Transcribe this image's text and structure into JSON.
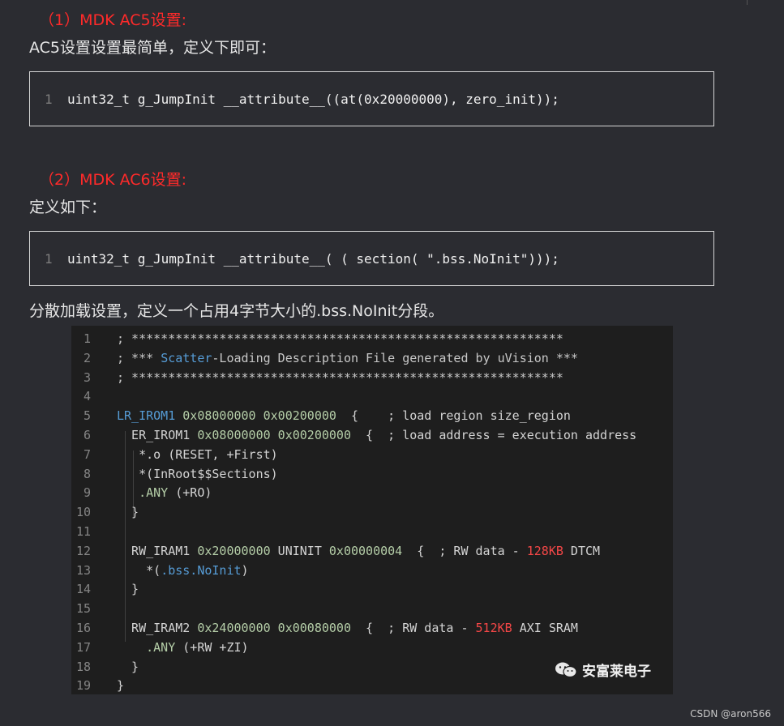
{
  "sections": {
    "ac5_title": "（1）MDK AC5设置:",
    "ac5_desc": "AC5设置设置最简单，定义下即可：",
    "ac5_code": {
      "line_no": "1",
      "code": "uint32_t g_JumpInit __attribute__((at(0x20000000), zero_init));"
    },
    "ac6_title": "（2）MDK AC6设置:",
    "ac6_desc": "定义如下：",
    "ac6_code": {
      "line_no": "1",
      "code": "uint32_t g_JumpInit __attribute__( ( section( \".bss.NoInit\")));"
    },
    "scatter_desc": "分散加载设置，定义一个占用4字节大小的.bss.NoInit分段。"
  },
  "scatter_lines": [
    {
      "no": "1",
      "segs": [
        {
          "t": "; ***********************************************************",
          "c": "cmt"
        }
      ]
    },
    {
      "no": "2",
      "segs": [
        {
          "t": "; *** ",
          "c": "cmt"
        },
        {
          "t": "Scatter",
          "c": "blue"
        },
        {
          "t": "-Loading Description File generated by uVision ***",
          "c": "cmt"
        }
      ]
    },
    {
      "no": "3",
      "segs": [
        {
          "t": "; ***********************************************************",
          "c": "cmt"
        }
      ]
    },
    {
      "no": "4",
      "segs": []
    },
    {
      "no": "5",
      "segs": [
        {
          "t": "LR_IROM1",
          "c": "blue"
        },
        {
          "t": " 0x08000000 0x00200000",
          "c": "green"
        },
        {
          "t": "  {    ; load region size_region",
          "c": ""
        }
      ]
    },
    {
      "no": "6",
      "segs": [
        {
          "t": "  ER_IROM1",
          "c": ""
        },
        {
          "t": " 0x08000000 0x00200000",
          "c": "green"
        },
        {
          "t": "  {  ; load address = execution address",
          "c": ""
        }
      ]
    },
    {
      "no": "7",
      "segs": [
        {
          "t": "   *.o (RESET, +First)",
          "c": ""
        }
      ]
    },
    {
      "no": "8",
      "segs": [
        {
          "t": "   *(InRoot$$Sections)",
          "c": ""
        }
      ]
    },
    {
      "no": "9",
      "segs": [
        {
          "t": "   .ANY",
          "c": "green"
        },
        {
          "t": " (+RO)",
          "c": ""
        }
      ]
    },
    {
      "no": "10",
      "segs": [
        {
          "t": "  }",
          "c": ""
        }
      ]
    },
    {
      "no": "11",
      "segs": []
    },
    {
      "no": "12",
      "segs": [
        {
          "t": "  RW_IRAM1",
          "c": ""
        },
        {
          "t": " 0x20000000",
          "c": "green"
        },
        {
          "t": " UNINIT",
          "c": ""
        },
        {
          "t": " 0x00000004",
          "c": "green"
        },
        {
          "t": "  {  ; RW data - ",
          "c": ""
        },
        {
          "t": "128KB",
          "c": "red"
        },
        {
          "t": " DTCM",
          "c": ""
        }
      ]
    },
    {
      "no": "13",
      "segs": [
        {
          "t": "    *(",
          "c": ""
        },
        {
          "t": ".bss.NoInit",
          "c": "blue"
        },
        {
          "t": ")",
          "c": ""
        }
      ]
    },
    {
      "no": "14",
      "segs": [
        {
          "t": "  }",
          "c": ""
        }
      ]
    },
    {
      "no": "15",
      "segs": []
    },
    {
      "no": "16",
      "segs": [
        {
          "t": "  RW_IRAM2",
          "c": ""
        },
        {
          "t": " 0x24000000 0x00080000",
          "c": "green"
        },
        {
          "t": "  {  ; RW data - ",
          "c": ""
        },
        {
          "t": "512KB",
          "c": "red"
        },
        {
          "t": " AXI SRAM",
          "c": ""
        }
      ]
    },
    {
      "no": "17",
      "segs": [
        {
          "t": "    .ANY",
          "c": "green"
        },
        {
          "t": " (+RW +ZI)",
          "c": ""
        }
      ]
    },
    {
      "no": "18",
      "segs": [
        {
          "t": "  }",
          "c": ""
        }
      ]
    },
    {
      "no": "19",
      "segs": [
        {
          "t": "}",
          "c": ""
        }
      ]
    }
  ],
  "watermark": {
    "icon": "wechat-icon",
    "text": "安富莱电子"
  },
  "footer": "CSDN @aron566"
}
